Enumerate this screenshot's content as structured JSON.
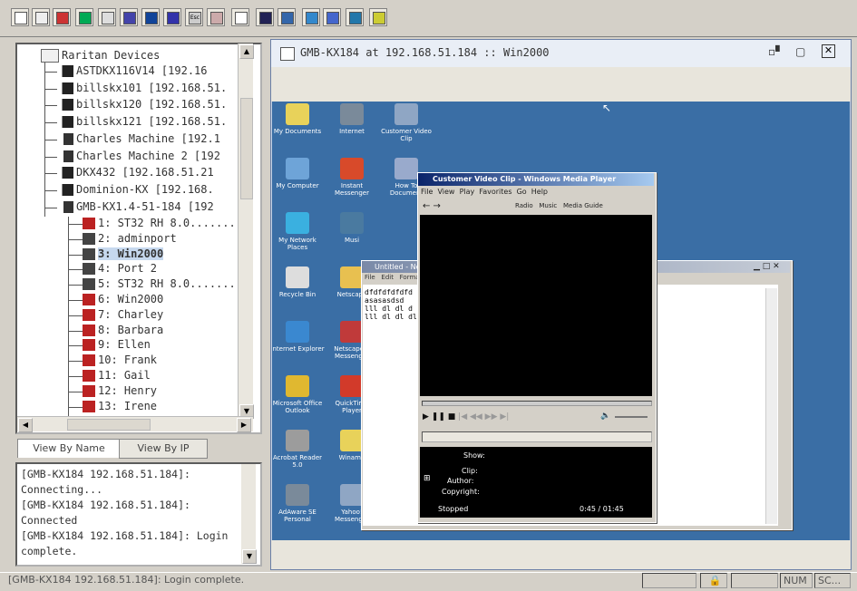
{
  "colors": {
    "desktop_blue": "#3a6ea5",
    "title_blue": "#0a246a",
    "selection": "#c6d8ee"
  },
  "toolbar": {
    "icons": [
      "new-icon",
      "properties-icon",
      "color-icon",
      "refresh-icon",
      "image-icon",
      "sync-icon",
      "connect-icon",
      "monitor-icon",
      "esc-icon",
      "grid-icon",
      "pointer-icon",
      "fullscreen-icon",
      "screen-icon",
      "window-icon",
      "split-icon",
      "globe-icon",
      "help-icon"
    ],
    "esc_label": "Esc"
  },
  "tree": {
    "root": "Raritan Devices",
    "devices": [
      "ASTDKX116V14 [192.16",
      "billskx101 [192.168.51.",
      "billskx120 [192.168.51.",
      "billskx121 [192.168.51.",
      "Charles Machine [192.1",
      "Charles Machine 2 [192",
      "DKX432 [192.168.51.21",
      "Dominion-KX [192.168.",
      "GMB-KX1.4-51-184 [192"
    ],
    "ports": [
      "1: ST32  RH 8.0........",
      "2: adminport",
      "3: Win2000",
      "4: Port 2",
      "5: ST32  RH 8.0........",
      "6: Win2000",
      "7: Charley",
      "8: Barbara",
      "9: Ellen",
      "10: Frank",
      "11: Gail",
      "12: Henry",
      "13: Irene"
    ]
  },
  "tabs": {
    "by_name": "View By Name",
    "by_ip": "View By IP"
  },
  "log": [
    "[GMB-KX184 192.168.51.184]:",
    "Connecting...",
    "[GMB-KX184 192.168.51.184]:",
    "Connected",
    "[GMB-KX184 192.168.51.184]: Login",
    "complete."
  ],
  "status": {
    "message": "[GMB-KX184 192.168.51.184]: Login complete.",
    "num": "NUM",
    "sc": "SC..."
  },
  "session": {
    "title": "GMB-KX184 at 192.168.51.184 :: Win2000",
    "desktop_icons": [
      [
        "My Documents",
        "Internet",
        "Customer Video Clip"
      ],
      [
        "My Computer",
        "Instant Messenger",
        "How To Document"
      ],
      [
        "My Network Places",
        "Musi"
      ],
      [
        "Recycle Bin",
        "Netscape"
      ],
      [
        "Internet Explorer",
        "Netscape 6 Messenger"
      ],
      [
        "Microsoft Office Outlook",
        "QuickTime Player"
      ],
      [
        "Acrobat Reader 5.0",
        "Winamp"
      ],
      [
        "AdAware SE Personal",
        "Yahoo! Messenger"
      ]
    ],
    "wmp": {
      "title": "Customer Video Clip - Windows Media Player",
      "menu": [
        "File",
        "View",
        "Play",
        "Favorites",
        "Go",
        "Help"
      ],
      "nav": [
        "Radio",
        "Music",
        "Media Guide"
      ],
      "info_lines": [
        "Show:",
        "Clip:",
        "Author:",
        "Copyright:"
      ],
      "status_left": "Stopped",
      "time": "0:45 / 01:45"
    },
    "notepad": {
      "title": "Untitled - Notepad",
      "menu": [
        "File",
        "Edit",
        "Format"
      ],
      "text_lines": [
        "dfdfdfdfdfd",
        "asasasdsd",
        "lll dl dl d",
        "lll dl dl dl dl"
      ]
    }
  }
}
